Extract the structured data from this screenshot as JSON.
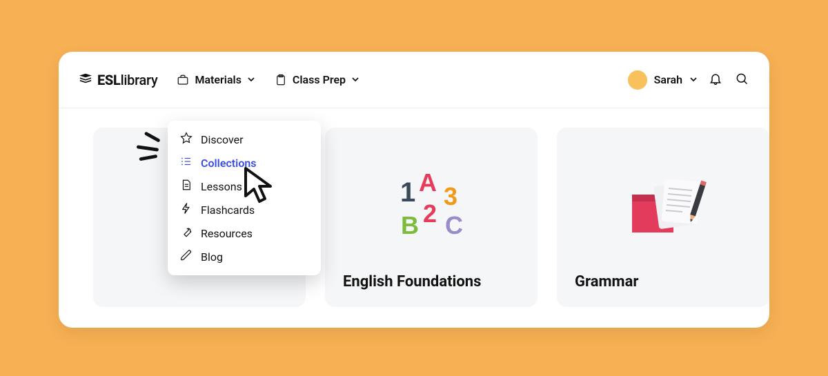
{
  "logo": {
    "bold": "ESL",
    "light": "library"
  },
  "nav": {
    "materials": "Materials",
    "class_prep": "Class Prep"
  },
  "user": {
    "name": "Sarah"
  },
  "dropdown": {
    "discover": "Discover",
    "collections": "Collections",
    "lessons": "Lessons",
    "flashcards": "Flashcards",
    "resources": "Resources",
    "blog": "Blog"
  },
  "cards": {
    "english_foundations": "English Foundations",
    "grammar": "Grammar"
  }
}
